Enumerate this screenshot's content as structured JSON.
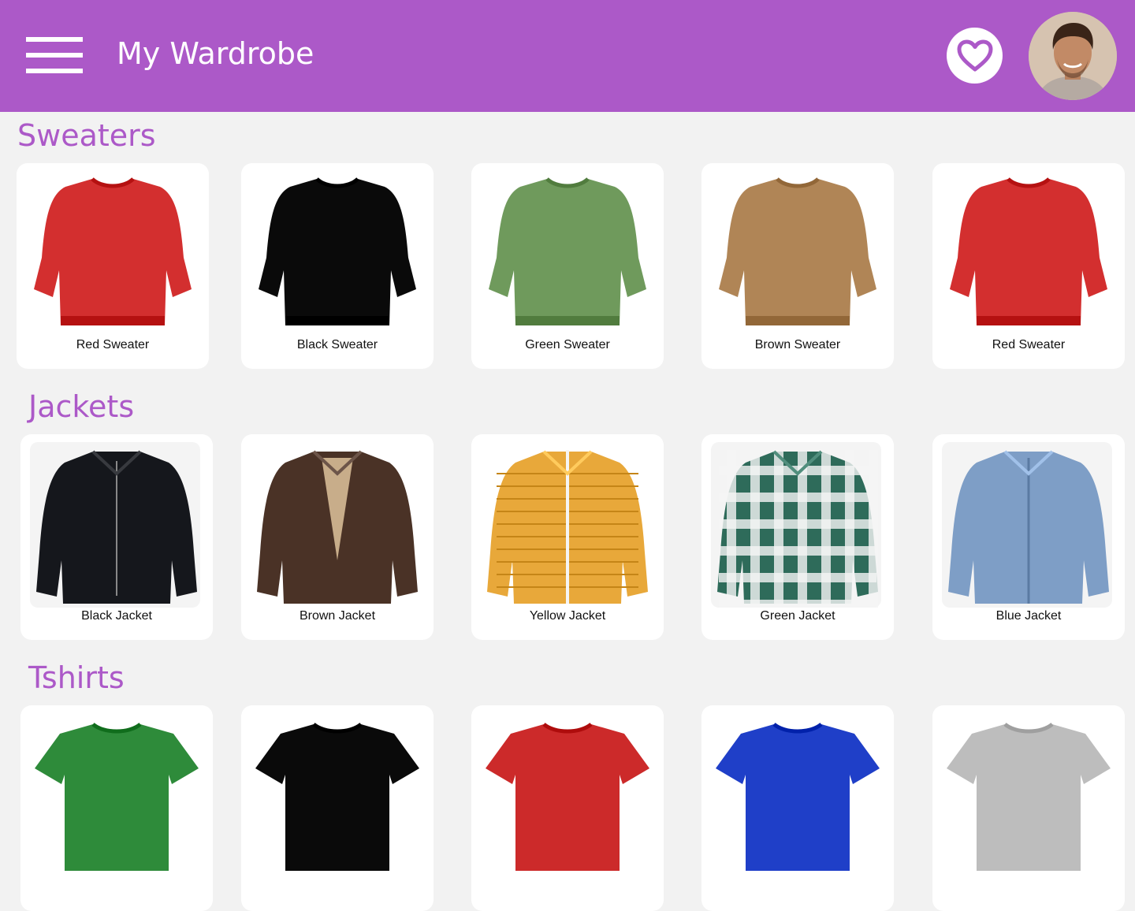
{
  "header": {
    "title": "My Wardrobe",
    "menu_icon": "hamburger-menu-icon",
    "favorites_icon": "heart-icon",
    "avatar": "user-avatar",
    "background_color": "#ac59c8"
  },
  "sections": [
    {
      "title": "Sweaters",
      "items": [
        {
          "label": "Red Sweater",
          "color": "#d32f2f"
        },
        {
          "label": "Black Sweater",
          "color": "#0a0a0a"
        },
        {
          "label": "Green Sweater",
          "color": "#6f9a5c"
        },
        {
          "label": "Brown Sweater",
          "color": "#b08556"
        },
        {
          "label": "Red Sweater",
          "color": "#d32f2f"
        }
      ]
    },
    {
      "title": "Jackets",
      "items": [
        {
          "label": "Black Jacket",
          "color": "#15171c"
        },
        {
          "label": "Brown Jacket",
          "color": "#4a3226"
        },
        {
          "label": "Yellow Jacket",
          "color": "#e8a83a"
        },
        {
          "label": "Green Jacket",
          "color": "#2e6b5a"
        },
        {
          "label": "Blue Jacket",
          "color": "#7e9ec6"
        }
      ]
    },
    {
      "title": "Tshirts",
      "items": [
        {
          "label": "",
          "color": "#2e8b3a"
        },
        {
          "label": "",
          "color": "#0a0a0a"
        },
        {
          "label": "",
          "color": "#cc2a2a"
        },
        {
          "label": "",
          "color": "#1f3fc8"
        },
        {
          "label": "",
          "color": "#bdbdbd"
        }
      ]
    }
  ]
}
